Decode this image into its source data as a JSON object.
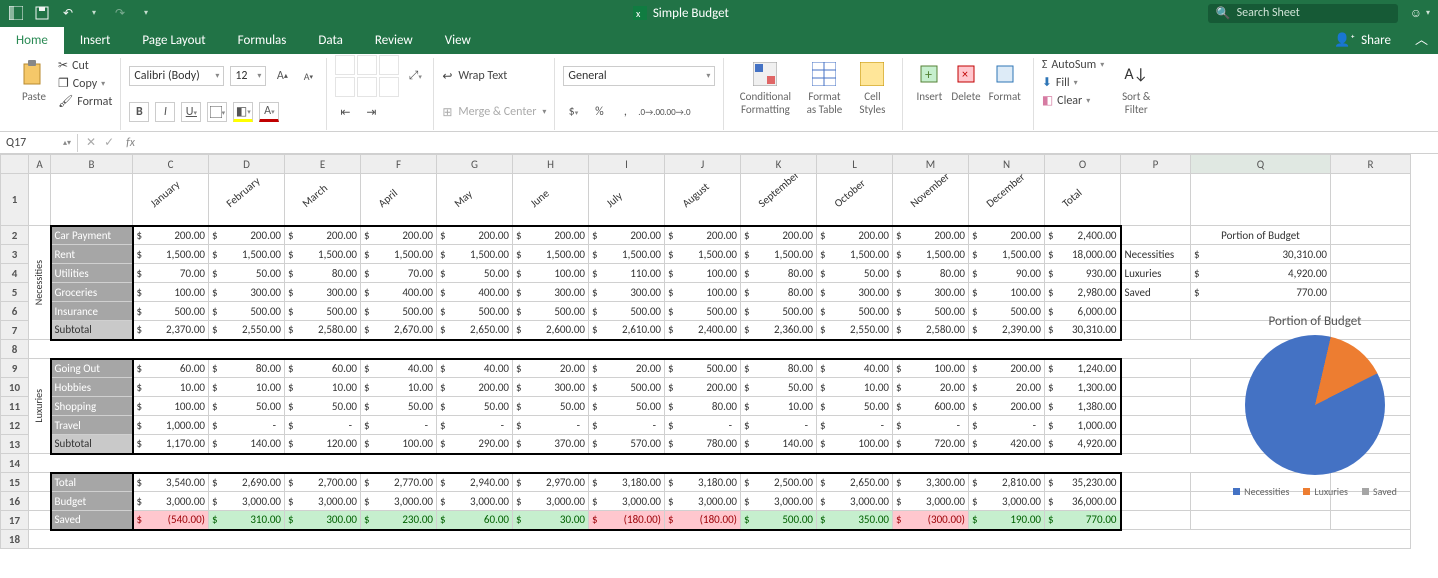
{
  "app": {
    "title": "Simple Budget",
    "search_placeholder": "Search Sheet"
  },
  "tabs": [
    "Home",
    "Insert",
    "Page Layout",
    "Formulas",
    "Data",
    "Review",
    "View"
  ],
  "share": "Share",
  "ribbon": {
    "paste": "Paste",
    "cut": "Cut",
    "copy": "Copy",
    "format": "Format",
    "font_name": "Calibri (Body)",
    "font_size": "12",
    "wrap": "Wrap Text",
    "merge": "Merge & Center",
    "num_format": "General",
    "cond": "Conditional Formatting",
    "fat": "Format as Table",
    "cstyles": "Cell Styles",
    "insert": "Insert",
    "delete": "Delete",
    "formatbtn": "Format",
    "autosum": "AutoSum",
    "fill": "Fill",
    "clear": "Clear",
    "sortfilter": "Sort & Filter"
  },
  "namebox": "Q17",
  "cols": [
    "A",
    "B",
    "C",
    "D",
    "E",
    "F",
    "G",
    "H",
    "I",
    "J",
    "K",
    "L",
    "M",
    "N",
    "O",
    "P",
    "Q",
    "R"
  ],
  "months": [
    "January",
    "February",
    "March",
    "April",
    "May",
    "June",
    "July",
    "August",
    "September",
    "October",
    "November",
    "December",
    "Total"
  ],
  "sections": {
    "nec_label": "Necessities",
    "lux_label": "Luxuries"
  },
  "rows": {
    "car": {
      "label": "Car Payment",
      "v": [
        "200.00",
        "200.00",
        "200.00",
        "200.00",
        "200.00",
        "200.00",
        "200.00",
        "200.00",
        "200.00",
        "200.00",
        "200.00",
        "200.00",
        "2,400.00"
      ]
    },
    "rent": {
      "label": "Rent",
      "v": [
        "1,500.00",
        "1,500.00",
        "1,500.00",
        "1,500.00",
        "1,500.00",
        "1,500.00",
        "1,500.00",
        "1,500.00",
        "1,500.00",
        "1,500.00",
        "1,500.00",
        "1,500.00",
        "18,000.00"
      ]
    },
    "util": {
      "label": "Utilities",
      "v": [
        "70.00",
        "50.00",
        "80.00",
        "70.00",
        "50.00",
        "100.00",
        "110.00",
        "100.00",
        "80.00",
        "50.00",
        "80.00",
        "90.00",
        "930.00"
      ]
    },
    "groc": {
      "label": "Groceries",
      "v": [
        "100.00",
        "300.00",
        "300.00",
        "400.00",
        "400.00",
        "300.00",
        "300.00",
        "100.00",
        "80.00",
        "300.00",
        "300.00",
        "100.00",
        "2,980.00"
      ]
    },
    "ins": {
      "label": "Insurance",
      "v": [
        "500.00",
        "500.00",
        "500.00",
        "500.00",
        "500.00",
        "500.00",
        "500.00",
        "500.00",
        "500.00",
        "500.00",
        "500.00",
        "500.00",
        "6,000.00"
      ]
    },
    "sub1": {
      "label": "Subtotal",
      "v": [
        "2,370.00",
        "2,550.00",
        "2,580.00",
        "2,670.00",
        "2,650.00",
        "2,600.00",
        "2,610.00",
        "2,400.00",
        "2,360.00",
        "2,550.00",
        "2,580.00",
        "2,390.00",
        "30,310.00"
      ]
    },
    "go": {
      "label": "Going Out",
      "v": [
        "60.00",
        "80.00",
        "60.00",
        "40.00",
        "40.00",
        "20.00",
        "20.00",
        "500.00",
        "80.00",
        "40.00",
        "100.00",
        "200.00",
        "1,240.00"
      ]
    },
    "hob": {
      "label": "Hobbies",
      "v": [
        "10.00",
        "10.00",
        "10.00",
        "10.00",
        "200.00",
        "300.00",
        "500.00",
        "200.00",
        "50.00",
        "10.00",
        "20.00",
        "20.00",
        "1,300.00"
      ]
    },
    "shop": {
      "label": "Shopping",
      "v": [
        "100.00",
        "50.00",
        "50.00",
        "50.00",
        "50.00",
        "50.00",
        "50.00",
        "80.00",
        "10.00",
        "50.00",
        "600.00",
        "200.00",
        "1,380.00"
      ]
    },
    "trav": {
      "label": "Travel",
      "v": [
        "1,000.00",
        "-",
        "-",
        "-",
        "-",
        "-",
        "-",
        "-",
        "-",
        "-",
        "-",
        "-",
        "1,000.00"
      ]
    },
    "sub2": {
      "label": "Subtotal",
      "v": [
        "1,170.00",
        "140.00",
        "120.00",
        "100.00",
        "290.00",
        "370.00",
        "570.00",
        "780.00",
        "140.00",
        "100.00",
        "720.00",
        "420.00",
        "4,920.00"
      ]
    },
    "tot": {
      "label": "Total",
      "v": [
        "3,540.00",
        "2,690.00",
        "2,700.00",
        "2,770.00",
        "2,940.00",
        "2,970.00",
        "3,180.00",
        "3,180.00",
        "2,500.00",
        "2,650.00",
        "3,300.00",
        "2,810.00",
        "35,230.00"
      ]
    },
    "bud": {
      "label": "Budget",
      "v": [
        "3,000.00",
        "3,000.00",
        "3,000.00",
        "3,000.00",
        "3,000.00",
        "3,000.00",
        "3,000.00",
        "3,000.00",
        "3,000.00",
        "3,000.00",
        "3,000.00",
        "3,000.00",
        "36,000.00"
      ]
    },
    "sav": {
      "label": "Saved",
      "v": [
        "(540.00)",
        "310.00",
        "300.00",
        "230.00",
        "60.00",
        "30.00",
        "(180.00)",
        "(180.00)",
        "500.00",
        "350.00",
        "(300.00)",
        "190.00",
        "770.00"
      ],
      "neg": [
        true,
        false,
        false,
        false,
        false,
        false,
        true,
        true,
        false,
        false,
        true,
        false,
        false
      ]
    }
  },
  "portion": {
    "title": "Portion of Budget",
    "items": [
      {
        "label": "Necessities",
        "val": "30,310.00"
      },
      {
        "label": "Luxuries",
        "val": "4,920.00"
      },
      {
        "label": "Saved",
        "val": "770.00"
      }
    ]
  },
  "chart_data": {
    "type": "pie",
    "title": "Portion of Budget",
    "series": [
      {
        "name": "Necessities",
        "value": 30310
      },
      {
        "name": "Luxuries",
        "value": 4920
      },
      {
        "name": "Saved",
        "value": 770
      }
    ],
    "colors": [
      "#4472c4",
      "#ed7d31",
      "#a5a5a5"
    ]
  }
}
